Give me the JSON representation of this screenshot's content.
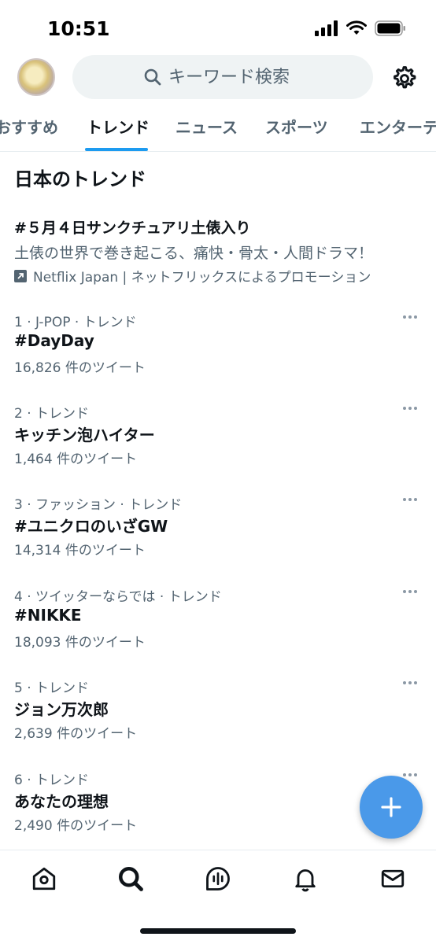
{
  "status": {
    "time": "10:51"
  },
  "search": {
    "placeholder": "キーワード検索"
  },
  "tabs": [
    "おすすめ",
    "トレンド",
    "ニュース",
    "スポーツ",
    "エンターテ"
  ],
  "active_tab": "トレンド",
  "section_title": "日本のトレンド",
  "promo": {
    "title": "#５月４日サンクチュアリ土俵入り",
    "subtitle": "土俵の世界で巻き起こる、痛快・骨太・人間ドラマ！",
    "by": "Netflix Japan | ネットフリックスによるプロモーション"
  },
  "trends": [
    {
      "meta": "1 · J-POP · トレンド",
      "name": "#DayDay",
      "count": "16,826 件のツイート"
    },
    {
      "meta": "2 · トレンド",
      "name": "キッチン泡ハイター",
      "count": "1,464 件のツイート"
    },
    {
      "meta": "3 · ファッション · トレンド",
      "name": "#ユニクロのいざGW",
      "count": "14,314 件のツイート"
    },
    {
      "meta": "4 · ツイッターならでは · トレンド",
      "name": "#NIKKE",
      "count": "18,093 件のツイート"
    },
    {
      "meta": "5 · トレンド",
      "name": "ジョン万次郎",
      "count": "2,639 件のツイート"
    },
    {
      "meta": "6 · トレンド",
      "name": "あなたの理想",
      "count": "2,490 件のツイート"
    }
  ],
  "colors": {
    "accent": "#1d9bf0",
    "fab": "#4a99e9",
    "text": "#0f1419",
    "secondary": "#536471"
  },
  "icons": {
    "nav": [
      "home-icon",
      "search-icon",
      "spaces-icon",
      "bell-icon",
      "mail-icon"
    ],
    "top": [
      "settings-icon",
      "search-icon"
    ],
    "fab": "plus-icon"
  }
}
